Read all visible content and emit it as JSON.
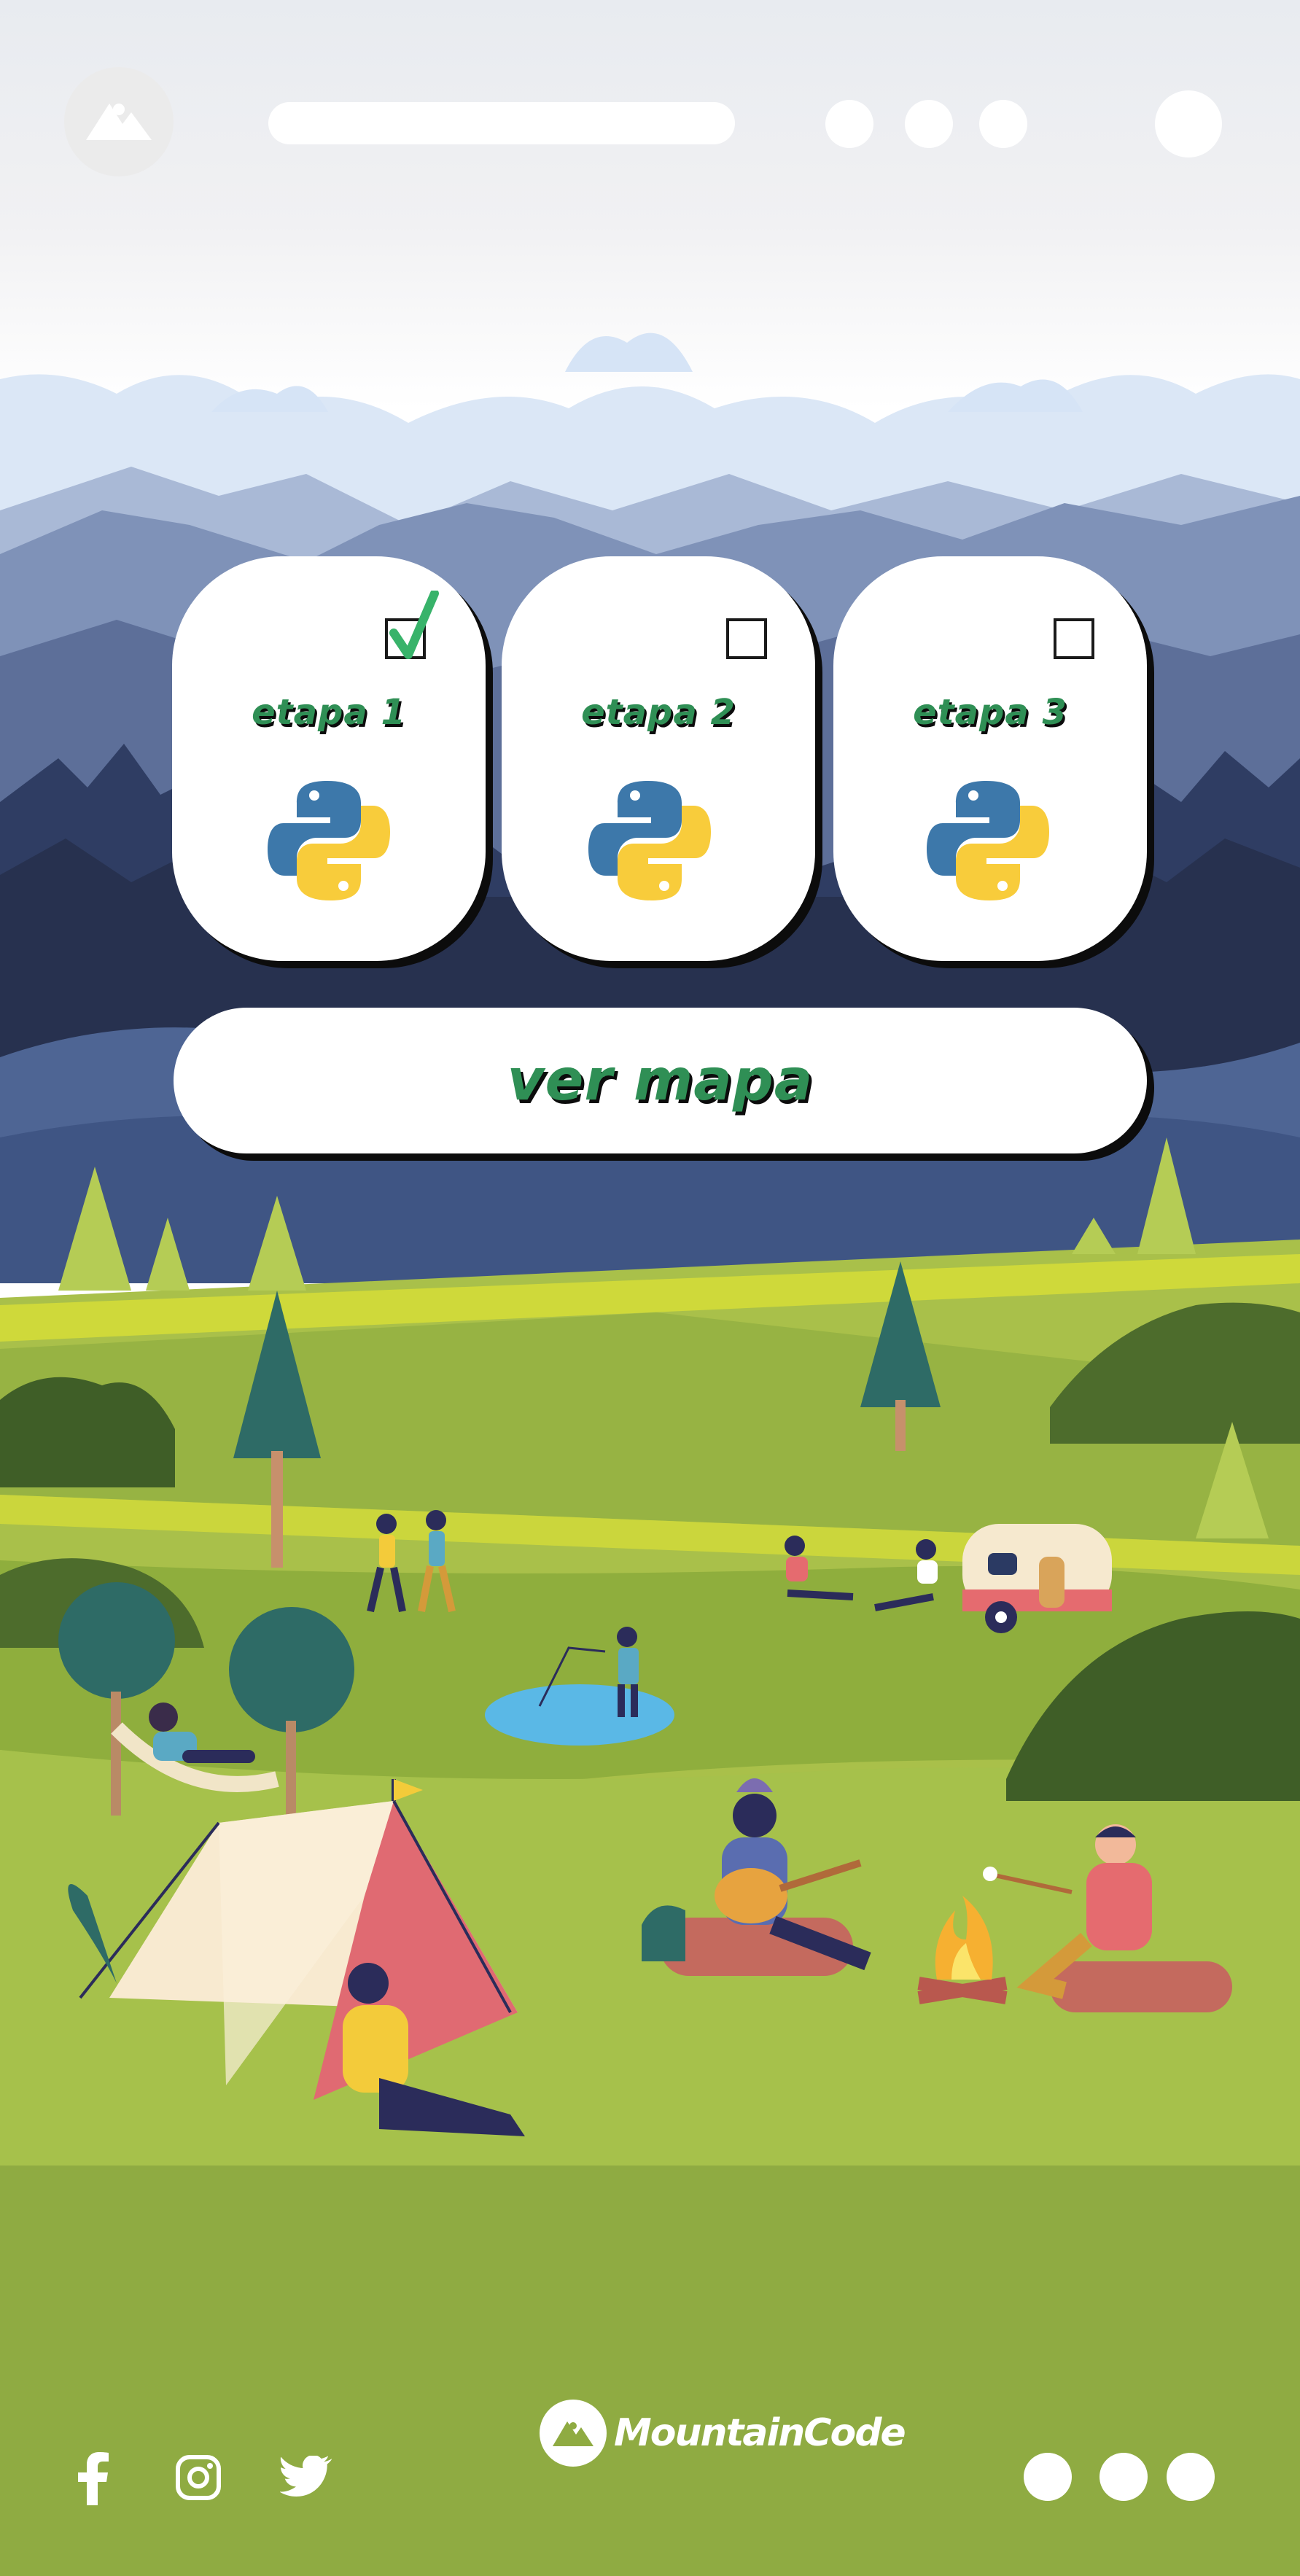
{
  "header": {
    "logo_icon": "mountain-logo-icon",
    "search_bar": "blank search pill",
    "menu_dots": 3,
    "profile_icon": "profile-dot"
  },
  "stages": [
    {
      "label": "etapa 1",
      "checked": true,
      "icon": "python-icon"
    },
    {
      "label": "etapa 2",
      "checked": false,
      "icon": "python-icon"
    },
    {
      "label": "etapa 3",
      "checked": false,
      "icon": "python-icon"
    }
  ],
  "map_button": {
    "label": "ver mapa"
  },
  "footer": {
    "brand": "MountainCode",
    "social_icons": [
      "facebook-icon",
      "instagram-icon",
      "twitter-icon"
    ],
    "dots": 3
  },
  "colors": {
    "accent_green": "#2f8f55",
    "check_green": "#38b36a",
    "footer_green": "#8fab42",
    "meadow_green": "#adc24a",
    "sky": "#dde9f7",
    "mountain_dark": "#2a3859"
  }
}
